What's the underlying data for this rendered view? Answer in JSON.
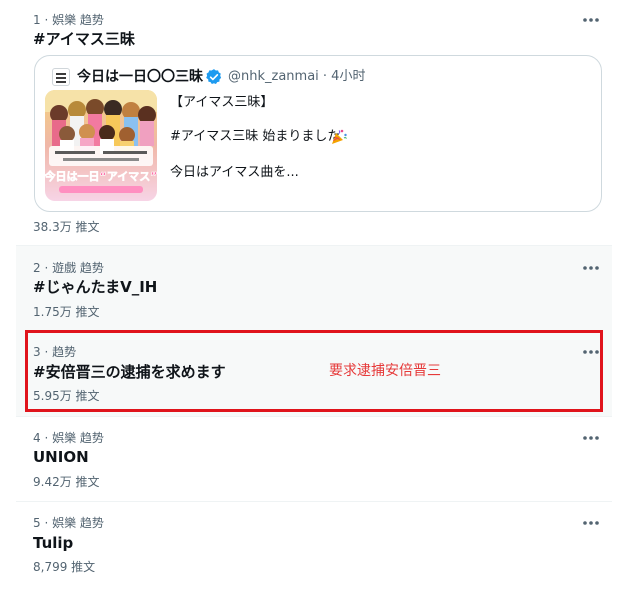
{
  "trends": [
    {
      "meta": "1 · 娯樂 趋势",
      "title": "#アイマス三昧",
      "count": "38.3万 推文",
      "card": {
        "account_name": "今日は一日〇〇三昧",
        "handle_time": "@nhk_zanmai · 4小时",
        "line1": "【アイマス三昧】",
        "line2": "#アイマス三昧 始まりました",
        "line3": "今日はアイマス曲を...",
        "thumbnail_text": "今日は一日“アイマス”"
      }
    },
    {
      "meta": "2 · 遊戲 趋势",
      "title": "#じゃんたまV_IH",
      "count": "1.75万 推文"
    },
    {
      "meta": "3 · 趋势",
      "title": "#安倍晋三の逮捕を求めます",
      "count": "5.95万 推文"
    },
    {
      "meta": "4 · 娯樂 趋势",
      "title": "UNION",
      "count": "9.42万 推文"
    },
    {
      "meta": "5 · 娯樂 趋势",
      "title": "Tulip",
      "count": "8,799 推文"
    }
  ],
  "annotation": "要求逮捕安倍晋三",
  "icons": {
    "more": "more-horizontal-icon",
    "verified": "verified-badge-icon",
    "party": "party-popper-icon"
  },
  "colors": {
    "highlight_border": "#e0141c",
    "annotation_text": "#e63a3a",
    "verified_blue": "#1d9bf0"
  }
}
